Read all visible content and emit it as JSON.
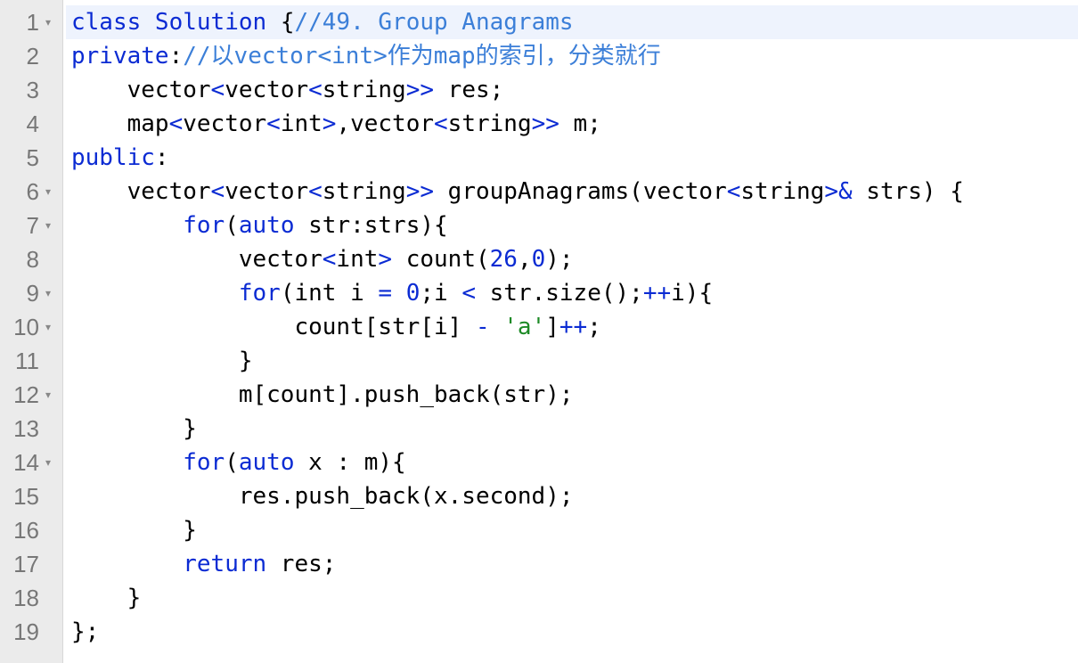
{
  "editor": {
    "lines": [
      {
        "number": "1",
        "fold": true,
        "active": true,
        "tokens": [
          {
            "t": "class ",
            "c": "kw"
          },
          {
            "t": "Solution ",
            "c": "kw"
          },
          {
            "t": "{",
            "c": "plain"
          },
          {
            "t": "//49. Group Anagrams",
            "c": "com"
          }
        ]
      },
      {
        "number": "2",
        "fold": false,
        "tokens": [
          {
            "t": "private",
            "c": "kw"
          },
          {
            "t": ":",
            "c": "plain"
          },
          {
            "t": "//以vector<int>作为map的索引，分类就行",
            "c": "com"
          }
        ]
      },
      {
        "number": "3",
        "fold": false,
        "tokens": [
          {
            "t": "    vector",
            "c": "plain"
          },
          {
            "t": "<",
            "c": "op"
          },
          {
            "t": "vector",
            "c": "plain"
          },
          {
            "t": "<",
            "c": "op"
          },
          {
            "t": "string",
            "c": "plain"
          },
          {
            "t": ">>",
            "c": "op"
          },
          {
            "t": " res;",
            "c": "plain"
          }
        ]
      },
      {
        "number": "4",
        "fold": false,
        "tokens": [
          {
            "t": "    map",
            "c": "plain"
          },
          {
            "t": "<",
            "c": "op"
          },
          {
            "t": "vector",
            "c": "plain"
          },
          {
            "t": "<",
            "c": "op"
          },
          {
            "t": "int",
            "c": "plain"
          },
          {
            "t": ">",
            "c": "op"
          },
          {
            "t": ",vector",
            "c": "plain"
          },
          {
            "t": "<",
            "c": "op"
          },
          {
            "t": "string",
            "c": "plain"
          },
          {
            "t": ">>",
            "c": "op"
          },
          {
            "t": " m;",
            "c": "plain"
          }
        ]
      },
      {
        "number": "5",
        "fold": false,
        "tokens": [
          {
            "t": "public",
            "c": "kw"
          },
          {
            "t": ":",
            "c": "plain"
          }
        ]
      },
      {
        "number": "6",
        "fold": true,
        "tokens": [
          {
            "t": "    vector",
            "c": "plain"
          },
          {
            "t": "<",
            "c": "op"
          },
          {
            "t": "vector",
            "c": "plain"
          },
          {
            "t": "<",
            "c": "op"
          },
          {
            "t": "string",
            "c": "plain"
          },
          {
            "t": ">>",
            "c": "op"
          },
          {
            "t": " groupAnagrams(vector",
            "c": "plain"
          },
          {
            "t": "<",
            "c": "op"
          },
          {
            "t": "string",
            "c": "plain"
          },
          {
            "t": ">&",
            "c": "op"
          },
          {
            "t": " strs) {",
            "c": "plain"
          }
        ]
      },
      {
        "number": "7",
        "fold": true,
        "tokens": [
          {
            "t": "        ",
            "c": "plain"
          },
          {
            "t": "for",
            "c": "kw"
          },
          {
            "t": "(",
            "c": "plain"
          },
          {
            "t": "auto",
            "c": "kw"
          },
          {
            "t": " str:strs){",
            "c": "plain"
          }
        ]
      },
      {
        "number": "8",
        "fold": false,
        "tokens": [
          {
            "t": "            vector",
            "c": "plain"
          },
          {
            "t": "<",
            "c": "op"
          },
          {
            "t": "int",
            "c": "plain"
          },
          {
            "t": ">",
            "c": "op"
          },
          {
            "t": " count(",
            "c": "plain"
          },
          {
            "t": "26",
            "c": "num"
          },
          {
            "t": ",",
            "c": "plain"
          },
          {
            "t": "0",
            "c": "num"
          },
          {
            "t": ");",
            "c": "plain"
          }
        ]
      },
      {
        "number": "9",
        "fold": true,
        "tokens": [
          {
            "t": "            ",
            "c": "plain"
          },
          {
            "t": "for",
            "c": "kw"
          },
          {
            "t": "(int i ",
            "c": "plain"
          },
          {
            "t": "=",
            "c": "op"
          },
          {
            "t": " ",
            "c": "plain"
          },
          {
            "t": "0",
            "c": "num"
          },
          {
            "t": ";i ",
            "c": "plain"
          },
          {
            "t": "<",
            "c": "op"
          },
          {
            "t": " str.size();",
            "c": "plain"
          },
          {
            "t": "++",
            "c": "op"
          },
          {
            "t": "i){",
            "c": "plain"
          }
        ]
      },
      {
        "number": "10",
        "fold": true,
        "tokens": [
          {
            "t": "                count[str[i] ",
            "c": "plain"
          },
          {
            "t": "-",
            "c": "op"
          },
          {
            "t": " ",
            "c": "plain"
          },
          {
            "t": "'a'",
            "c": "str"
          },
          {
            "t": "]",
            "c": "plain"
          },
          {
            "t": "++",
            "c": "op"
          },
          {
            "t": ";",
            "c": "plain"
          }
        ]
      },
      {
        "number": "11",
        "fold": false,
        "tokens": [
          {
            "t": "            }",
            "c": "plain"
          }
        ]
      },
      {
        "number": "12",
        "fold": true,
        "tokens": [
          {
            "t": "            m[count].push_back(str);",
            "c": "plain"
          }
        ]
      },
      {
        "number": "13",
        "fold": false,
        "tokens": [
          {
            "t": "        }",
            "c": "plain"
          }
        ]
      },
      {
        "number": "14",
        "fold": true,
        "tokens": [
          {
            "t": "        ",
            "c": "plain"
          },
          {
            "t": "for",
            "c": "kw"
          },
          {
            "t": "(",
            "c": "plain"
          },
          {
            "t": "auto",
            "c": "kw"
          },
          {
            "t": " x : m){",
            "c": "plain"
          }
        ]
      },
      {
        "number": "15",
        "fold": false,
        "tokens": [
          {
            "t": "            res.push_back(x.second);",
            "c": "plain"
          }
        ]
      },
      {
        "number": "16",
        "fold": false,
        "tokens": [
          {
            "t": "        }",
            "c": "plain"
          }
        ]
      },
      {
        "number": "17",
        "fold": false,
        "tokens": [
          {
            "t": "        ",
            "c": "plain"
          },
          {
            "t": "return",
            "c": "kw"
          },
          {
            "t": " res;",
            "c": "plain"
          }
        ]
      },
      {
        "number": "18",
        "fold": false,
        "tokens": [
          {
            "t": "    }",
            "c": "plain"
          }
        ]
      },
      {
        "number": "19",
        "fold": false,
        "tokens": [
          {
            "t": "};",
            "c": "plain"
          }
        ]
      }
    ],
    "fold_icon": "fold-triangle-icon",
    "colors": {
      "keyword": "#0b2bd3",
      "comment": "#3c7fd8",
      "string": "#1d8a26",
      "gutter_bg": "#ebebeb",
      "active_line_bg": "#eef3fd"
    }
  }
}
